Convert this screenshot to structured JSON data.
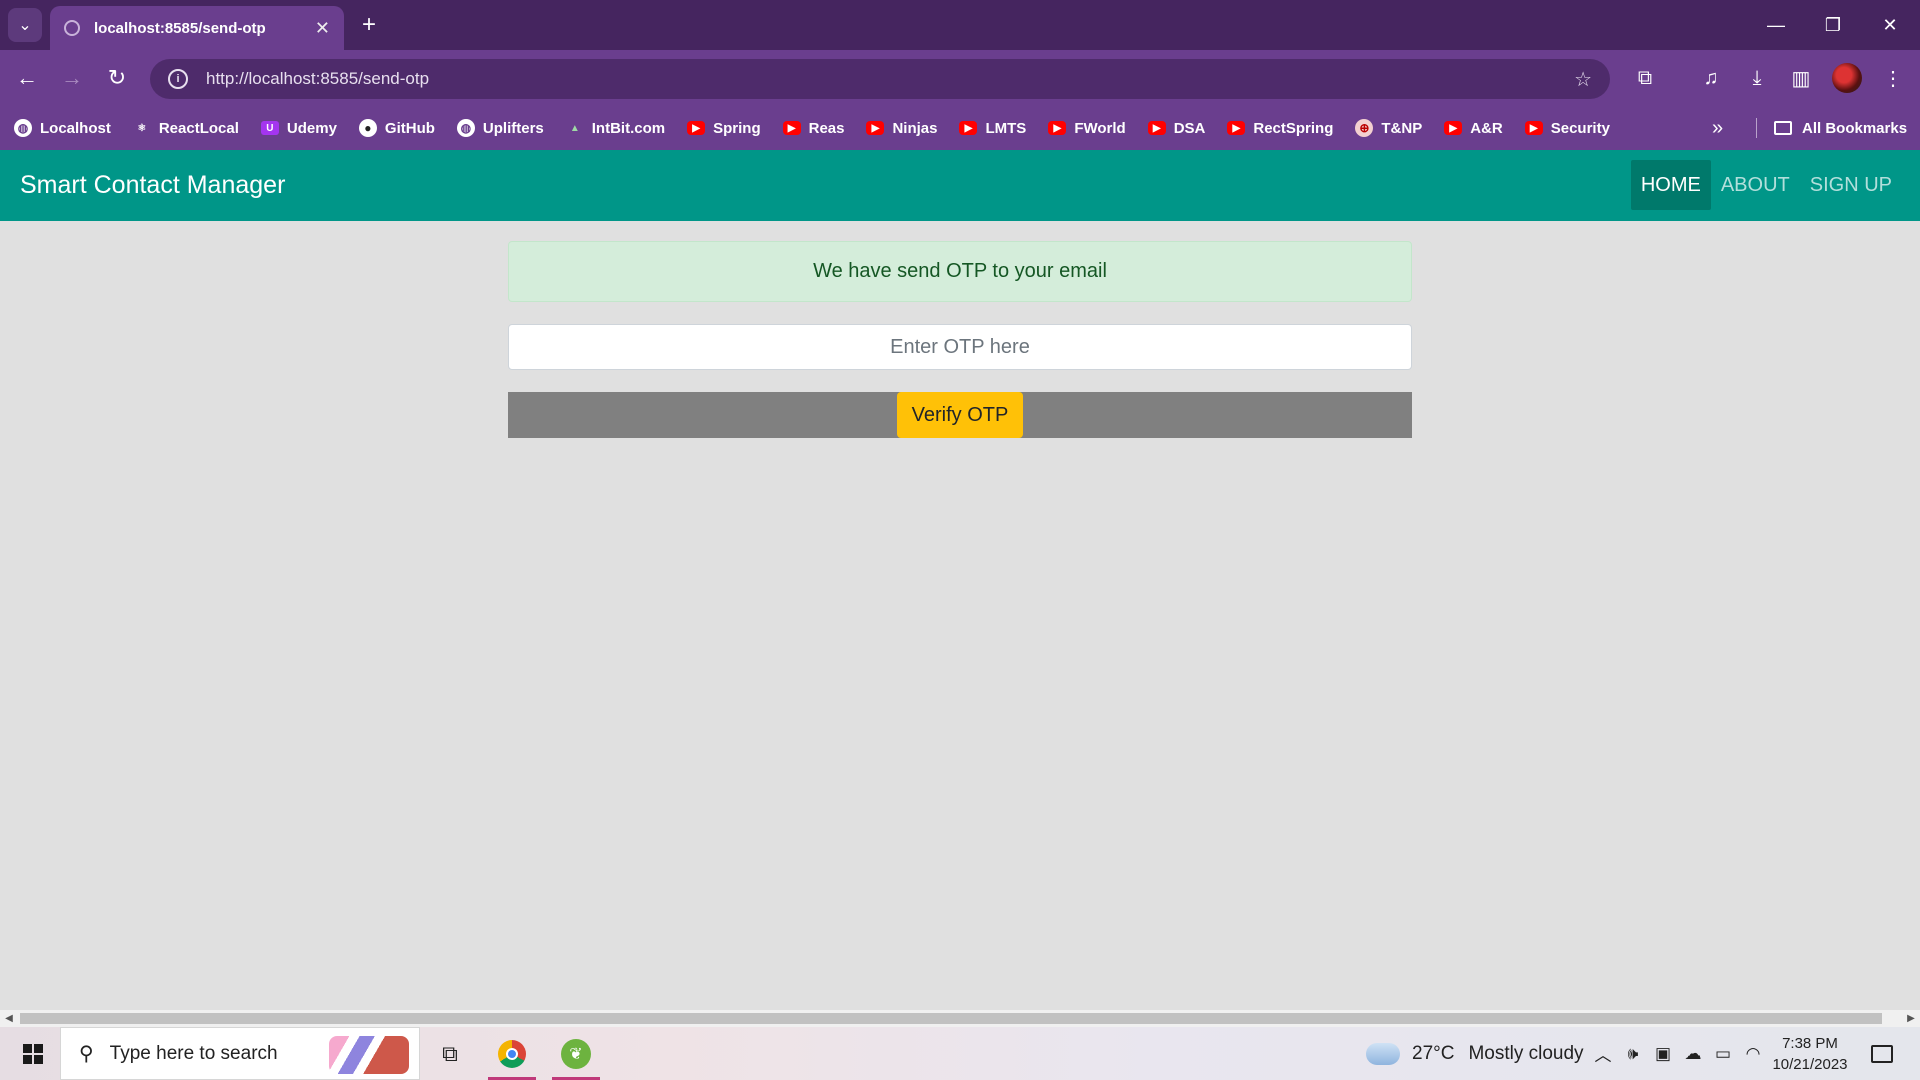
{
  "browser": {
    "tab_title": "localhost:8585/send-otp",
    "tab_close": "✕",
    "new_tab": "+",
    "url": "http://localhost:8585/send-otp",
    "window": {
      "minimize": "—",
      "restore": "❐",
      "close": "✕"
    }
  },
  "bookmarks": {
    "items": [
      {
        "label": "Localhost",
        "icon": "globe-icon"
      },
      {
        "label": "ReactLocal",
        "icon": "react-icon"
      },
      {
        "label": "Udemy",
        "icon": "udemy-icon"
      },
      {
        "label": "GitHub",
        "icon": "github-icon"
      },
      {
        "label": "Uplifters",
        "icon": "globe-icon"
      },
      {
        "label": "IntBit.com",
        "icon": "intbit-icon"
      },
      {
        "label": "Spring",
        "icon": "youtube-icon"
      },
      {
        "label": "Reas",
        "icon": "youtube-icon"
      },
      {
        "label": "Ninjas",
        "icon": "youtube-icon"
      },
      {
        "label": "LMTS",
        "icon": "youtube-icon"
      },
      {
        "label": "FWorld",
        "icon": "youtube-icon"
      },
      {
        "label": "DSA",
        "icon": "youtube-icon"
      },
      {
        "label": "RectSpring",
        "icon": "youtube-icon"
      },
      {
        "label": "T&NP",
        "icon": "tnp-icon"
      },
      {
        "label": "A&R",
        "icon": "youtube-icon"
      },
      {
        "label": "Security",
        "icon": "youtube-icon"
      }
    ],
    "more": "»",
    "all_bookmarks": "All Bookmarks"
  },
  "app": {
    "brand": "Smart Contact Manager",
    "nav": {
      "home": "HOME",
      "about": "ABOUT",
      "signup": "SIGN UP"
    },
    "alert": "We have send OTP to your email",
    "otp_placeholder": "Enter OTP here",
    "verify_label": "Verify OTP"
  },
  "taskbar": {
    "search_placeholder": "Type here to search",
    "weather_temp": "27°C",
    "weather_desc": "Mostly cloudy",
    "time": "7:38 PM",
    "date": "10/21/2023"
  },
  "colors": {
    "browser_frame": "#45255f",
    "browser_toolbar": "#6a3e8e",
    "navbar": "#009688",
    "navbar_active": "#00796b",
    "alert_bg": "#d4edda",
    "verify_button": "#ffc107",
    "verify_bar": "#808080"
  }
}
